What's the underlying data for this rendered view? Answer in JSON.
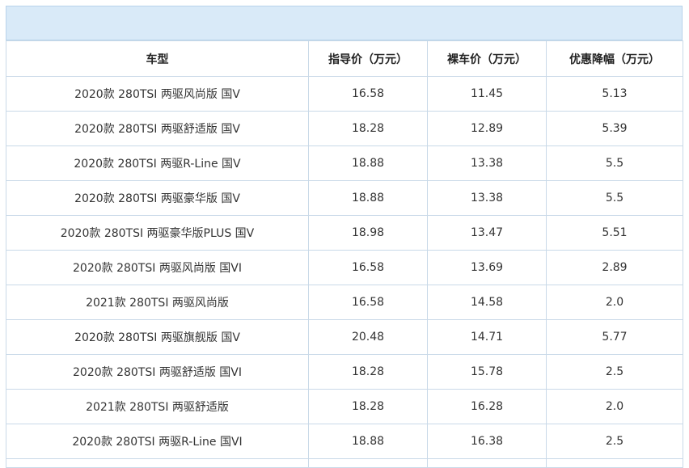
{
  "table": {
    "headers": [
      "车型",
      "指导价（万元）",
      "裸车价（万元）",
      "优惠降幅（万元）"
    ],
    "rows": [
      [
        "2020款 280TSI 两驱风尚版 国V",
        "16.58",
        "11.45",
        "5.13"
      ],
      [
        "2020款 280TSI 两驱舒适版 国V",
        "18.28",
        "12.89",
        "5.39"
      ],
      [
        "2020款 280TSI 两驱R-Line 国V",
        "18.88",
        "13.38",
        "5.5"
      ],
      [
        "2020款 280TSI 两驱豪华版 国V",
        "18.88",
        "13.38",
        "5.5"
      ],
      [
        "2020款 280TSI 两驱豪华版PLUS 国V",
        "18.98",
        "13.47",
        "5.51"
      ],
      [
        "2020款 280TSI 两驱风尚版 国VI",
        "16.58",
        "13.69",
        "2.89"
      ],
      [
        "2021款 280TSI 两驱风尚版",
        "16.58",
        "14.58",
        "2.0"
      ],
      [
        "2020款 280TSI 两驱旗舰版 国V",
        "20.48",
        "14.71",
        "5.77"
      ],
      [
        "2020款 280TSI 两驱舒适版 国VI",
        "18.28",
        "15.78",
        "2.5"
      ],
      [
        "2021款 280TSI 两驱舒适版",
        "18.28",
        "16.28",
        "2.0"
      ],
      [
        "2020款 280TSI 两驱R-Line 国VI",
        "18.88",
        "16.38",
        "2.5"
      ]
    ]
  }
}
